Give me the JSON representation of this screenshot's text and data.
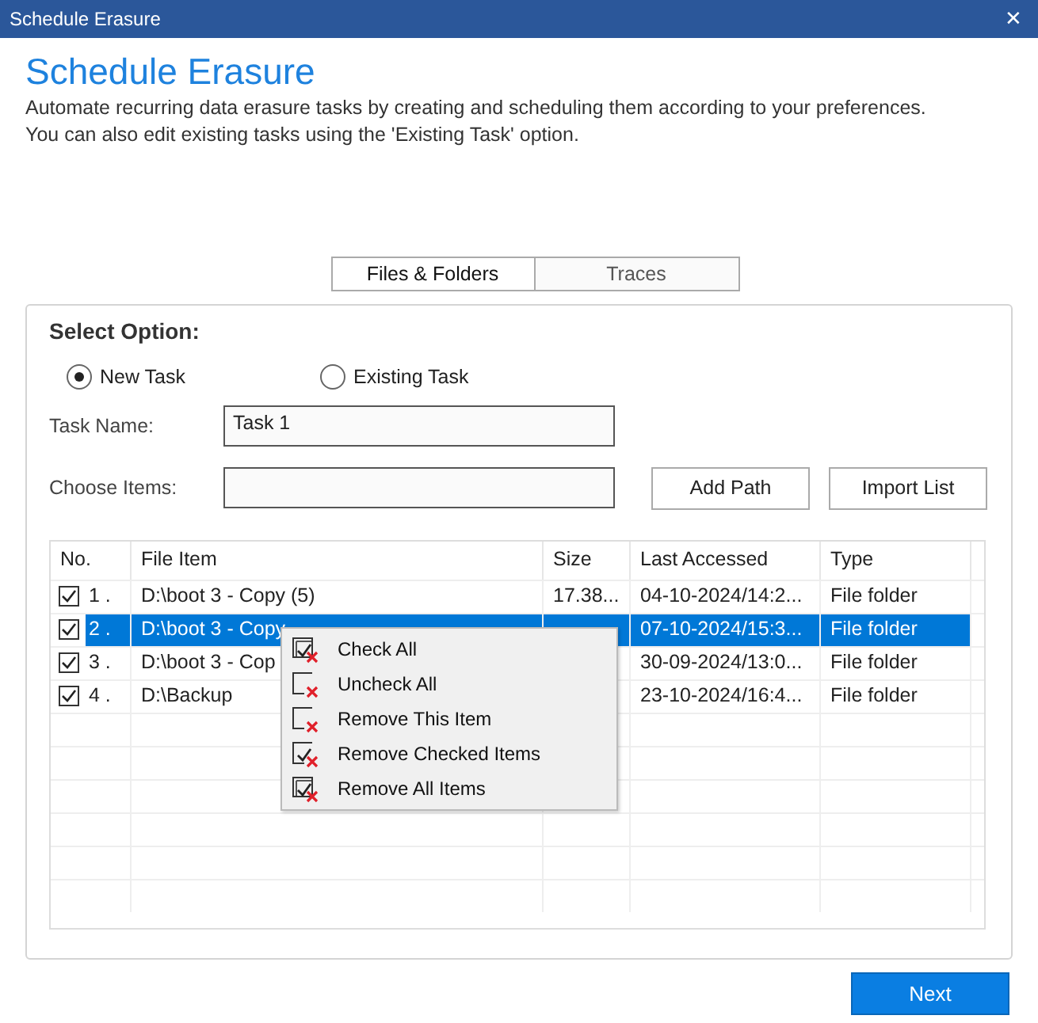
{
  "window": {
    "title": "Schedule Erasure",
    "close": "✕"
  },
  "heading": "Schedule Erasure",
  "description": [
    "Automate recurring data erasure tasks by creating and scheduling them according to your preferences.",
    "You can also edit existing tasks using the 'Existing Task' option."
  ],
  "tabs": [
    {
      "label": "Files & Folders",
      "selected": true
    },
    {
      "label": "Traces",
      "selected": false
    }
  ],
  "panel": {
    "title": "Select Option:",
    "radios": [
      {
        "label": "New Task",
        "selected": true
      },
      {
        "label": "Existing Task",
        "selected": false
      }
    ],
    "task_name": {
      "label": "Task Name:",
      "value": "Task 1"
    },
    "choose_items": {
      "label": "Choose Items:"
    },
    "buttons": [
      "Add Path",
      "Import List"
    ]
  },
  "table": {
    "columns": [
      "No.",
      "File Item",
      "Size",
      "Last Accessed",
      "Type"
    ],
    "rows": [
      {
        "checked": true,
        "selected": false,
        "no": "1 .",
        "file": "D:\\boot 3 - Copy (5)",
        "size": "17.38...",
        "accessed": "04-10-2024/14:2...",
        "type": "File folder"
      },
      {
        "checked": true,
        "selected": true,
        "no": "2 .",
        "file": "D:\\boot 3 - Copy",
        "size": "",
        "accessed": "07-10-2024/15:3...",
        "type": "File folder"
      },
      {
        "checked": true,
        "selected": false,
        "no": "3 .",
        "file": "D:\\boot 3 - Cop",
        "size": "",
        "accessed": "30-09-2024/13:0...",
        "type": "File folder"
      },
      {
        "checked": true,
        "selected": false,
        "no": "4 .",
        "file": "D:\\Backup",
        "size": "",
        "accessed": "23-10-2024/16:4...",
        "type": "File folder"
      }
    ]
  },
  "context_menu": [
    {
      "label": "Check All",
      "kind": "stacked"
    },
    {
      "label": "Uncheck All",
      "kind": "empty"
    },
    {
      "label": "Remove This Item",
      "kind": "empty"
    },
    {
      "label": "Remove Checked Items",
      "kind": "checked"
    },
    {
      "label": "Remove All Items",
      "kind": "stacked"
    }
  ],
  "next_button": "Next"
}
